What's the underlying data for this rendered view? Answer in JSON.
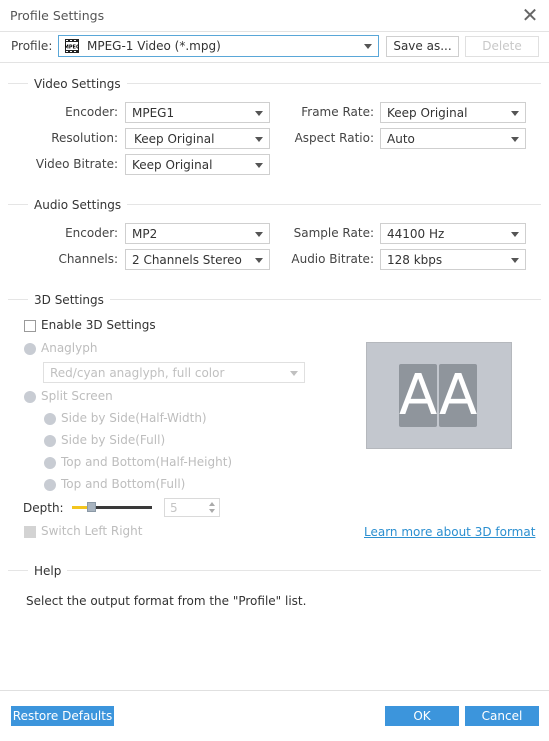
{
  "window": {
    "title": "Profile Settings",
    "close_icon": "close-icon"
  },
  "profile": {
    "label": "Profile:",
    "icon": "mpeg-film-icon",
    "value": "MPEG-1 Video (*.mpg)",
    "save_as_label": "Save as...",
    "delete_label": "Delete"
  },
  "video": {
    "title": "Video Settings",
    "encoder_label": "Encoder:",
    "encoder_value": "MPEG1",
    "resolution_label": "Resolution:",
    "resolution_value": "Keep Original",
    "bitrate_label": "Video Bitrate:",
    "bitrate_value": "Keep Original",
    "framerate_label": "Frame Rate:",
    "framerate_value": "Keep Original",
    "aspect_label": "Aspect Ratio:",
    "aspect_value": "Auto"
  },
  "audio": {
    "title": "Audio Settings",
    "encoder_label": "Encoder:",
    "encoder_value": "MP2",
    "channels_label": "Channels:",
    "channels_value": "2 Channels Stereo",
    "samplerate_label": "Sample Rate:",
    "samplerate_value": "44100 Hz",
    "bitrate_label": "Audio Bitrate:",
    "bitrate_value": "128 kbps"
  },
  "three_d": {
    "title": "3D Settings",
    "enable_label": "Enable 3D Settings",
    "enabled": false,
    "anaglyph_label": "Anaglyph",
    "anaglyph_value": "Red/cyan anaglyph, full color",
    "split_label": "Split Screen",
    "split_options": [
      "Side by Side(Half-Width)",
      "Side by Side(Full)",
      "Top and Bottom(Half-Height)",
      "Top and Bottom(Full)"
    ],
    "depth_label": "Depth:",
    "depth_value": "5",
    "depth_fraction": 0.25,
    "switch_label": "Switch Left Right",
    "preview_text_left": "A",
    "preview_text_right": "A",
    "learn_more_label": "Learn more about 3D format"
  },
  "help": {
    "title": "Help",
    "text": "Select the output format from the \"Profile\" list."
  },
  "footer": {
    "restore_label": "Restore Defaults",
    "ok_label": "OK",
    "cancel_label": "Cancel"
  },
  "colors": {
    "accent": "#3c95dc",
    "link": "#2b8fd0",
    "slider_fill": "#f3c51e"
  }
}
